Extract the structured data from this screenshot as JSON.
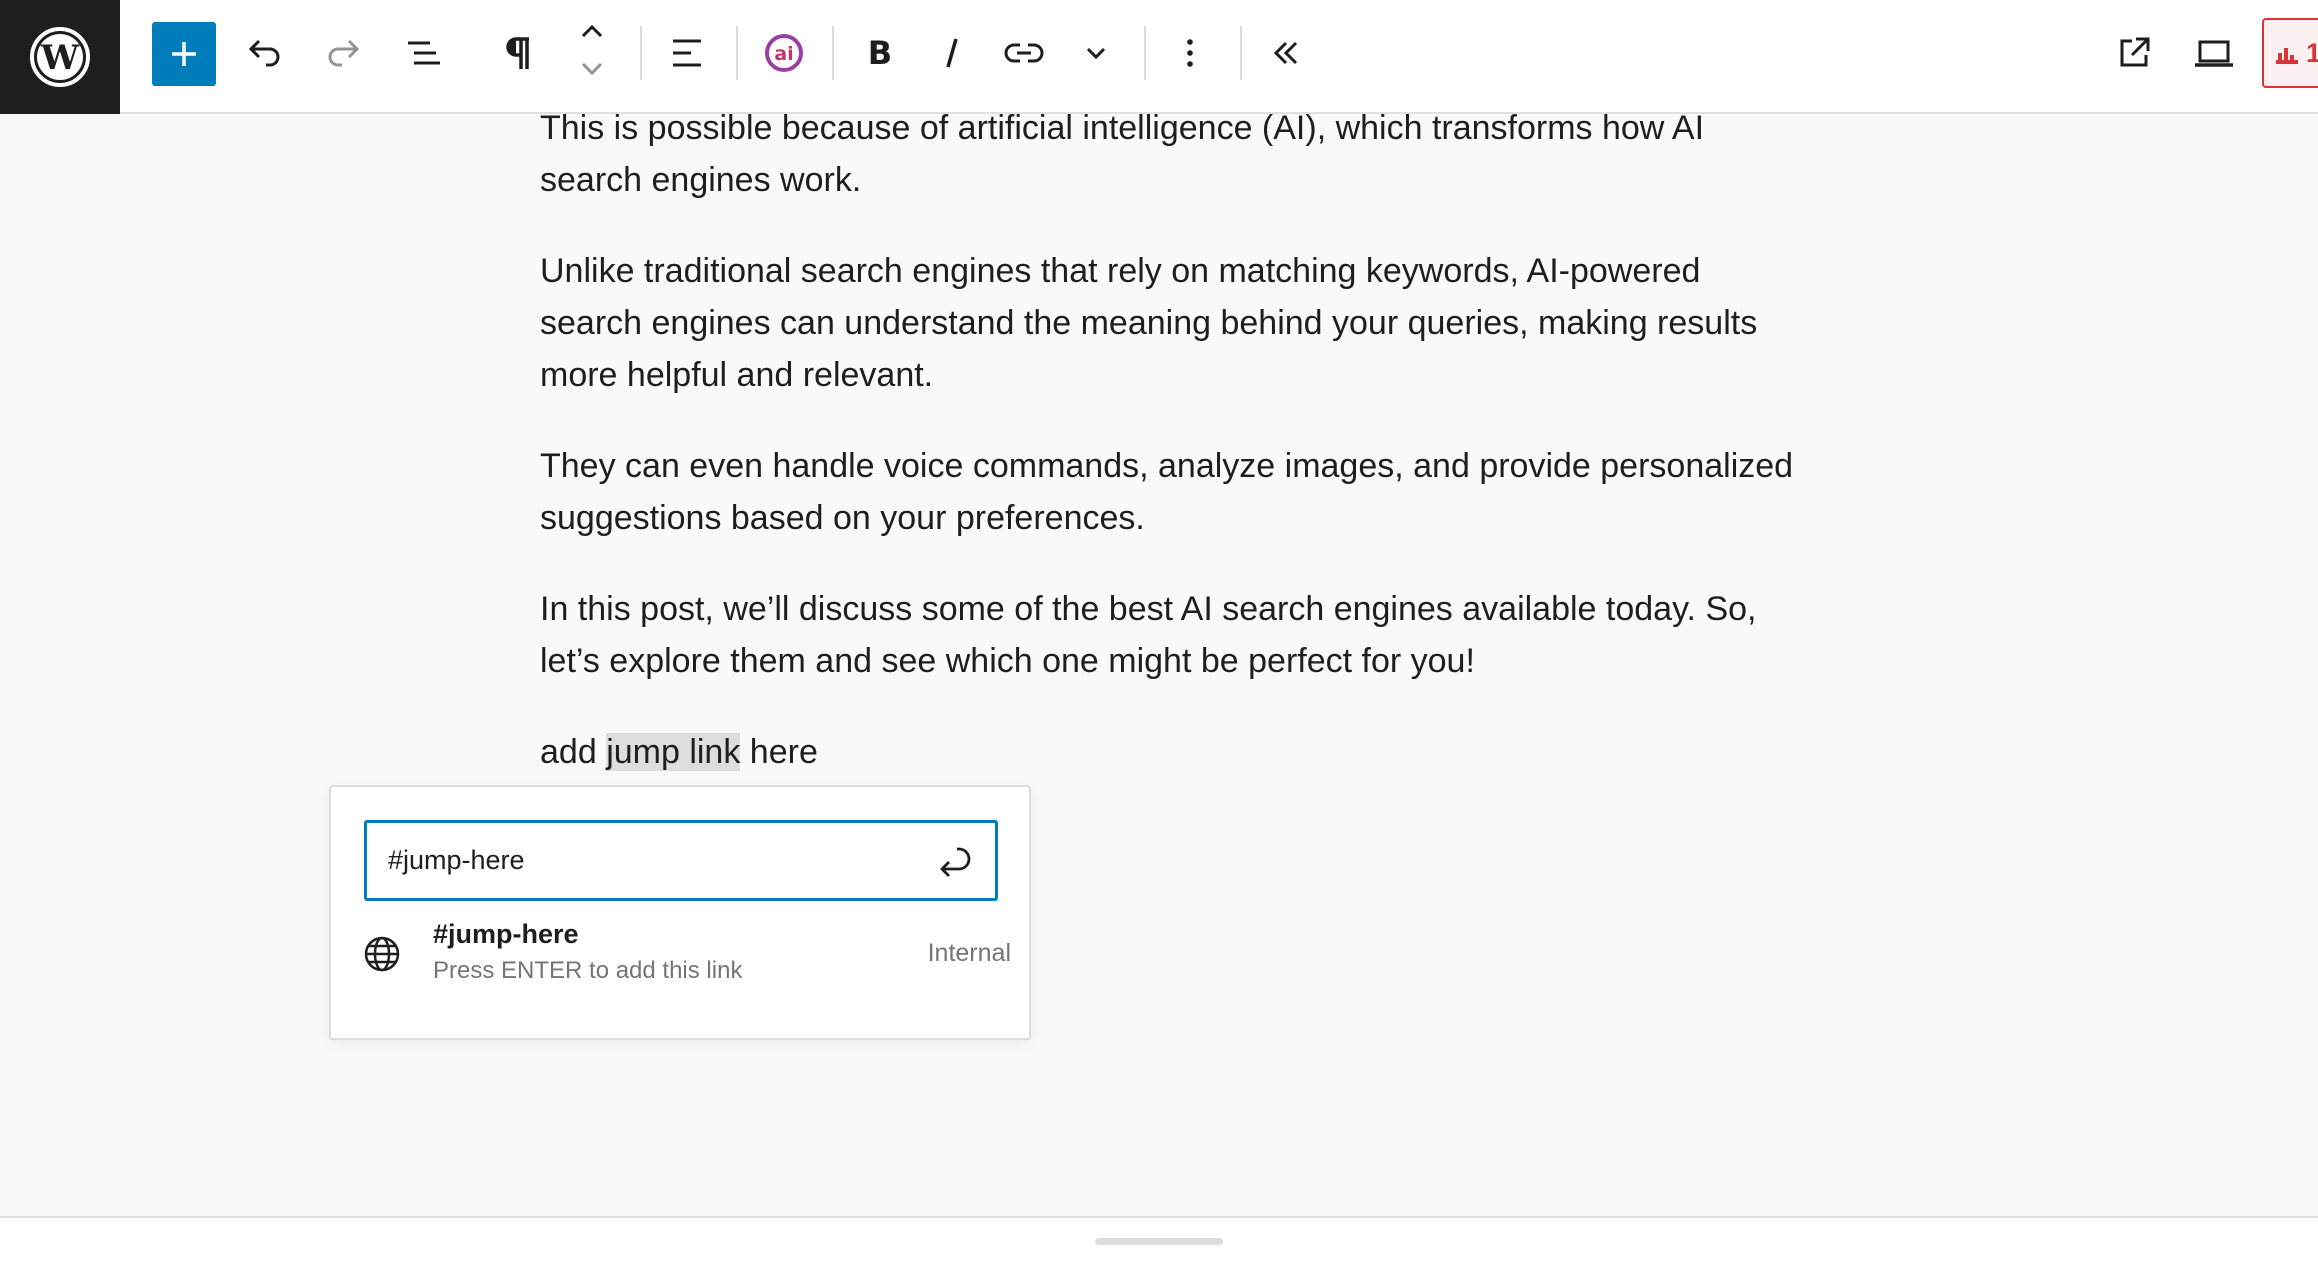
{
  "toolbar": {
    "logo_icon": "wordpress-logo",
    "buttons": [
      {
        "name": "add-block",
        "icon": "plus-icon"
      },
      {
        "name": "undo",
        "icon": "undo-icon"
      },
      {
        "name": "redo",
        "icon": "redo-icon"
      },
      {
        "name": "document-overview",
        "icon": "list-view-icon"
      },
      {
        "name": "paragraph-block",
        "icon": "pilcrow-icon"
      },
      {
        "name": "move-up",
        "icon": "chevron-up-icon"
      },
      {
        "name": "move-down",
        "icon": "chevron-down-icon"
      },
      {
        "name": "align",
        "icon": "align-left-icon"
      },
      {
        "name": "ai-assistant",
        "icon": "ai-icon"
      },
      {
        "name": "bold",
        "icon": "bold-icon"
      },
      {
        "name": "italic",
        "icon": "italic-icon"
      },
      {
        "name": "link",
        "icon": "link-icon"
      },
      {
        "name": "more-rich-text",
        "icon": "chevron-down-icon"
      },
      {
        "name": "options",
        "icon": "more-vertical-icon"
      },
      {
        "name": "collapse",
        "icon": "chevrons-left-icon"
      },
      {
        "name": "view-post",
        "icon": "external-icon"
      },
      {
        "name": "preview-device",
        "icon": "desktop-icon"
      }
    ],
    "badge_count": "1",
    "colors": {
      "accent": "#007cba",
      "badge": "#d63638",
      "ai": "#9b3fa6"
    }
  },
  "content": {
    "paragraphs": [
      "This is possible because of artificial intelligence (AI), which transforms how AI search engines work.",
      "Unlike traditional search engines that rely on matching keywords, AI-powered search engines can understand the meaning behind your queries, making results more helpful and relevant.",
      "They can even handle voice commands, analyze images, and provide personalized suggestions based on your preferences.",
      "In this post, we’ll discuss some of the best AI search engines available today. So, let’s explore them and see which one might be perfect for you!"
    ],
    "last_paragraph": {
      "before": "add ",
      "highlighted": "jump link",
      "after": " here"
    }
  },
  "link_popover": {
    "input_value": "#jump-here",
    "suggestion": {
      "title": "#jump-here",
      "subtitle": "Press ENTER to add this link",
      "type": "Internal",
      "icon": "globe-icon"
    }
  }
}
